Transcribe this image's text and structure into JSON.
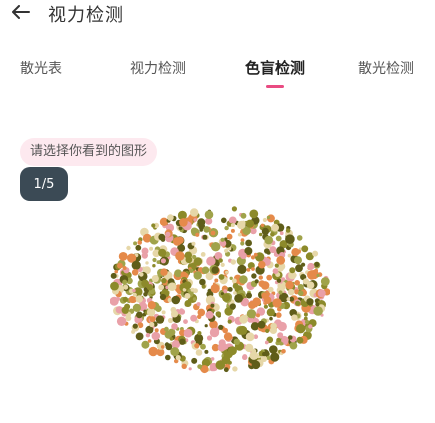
{
  "header": {
    "back_icon": "arrow-left-icon",
    "title": "视力检测"
  },
  "tabs": [
    {
      "label": "散光表",
      "active": false
    },
    {
      "label": "视力检测",
      "active": false
    },
    {
      "label": "色盲检测",
      "active": true
    },
    {
      "label": "散光检测",
      "active": false
    }
  ],
  "instruction": "请选择你看到的图形",
  "progress": "1/5",
  "plate": {
    "type": "ishihara-color-plate",
    "colors": {
      "pink": "#e9a0a8",
      "orange": "#e58a4a",
      "beige": "#e6d7a8",
      "olive": "#8c8a2a",
      "darkolive": "#5f5d19",
      "green": "#a0a34a"
    }
  },
  "accent_color": "#e94b82"
}
